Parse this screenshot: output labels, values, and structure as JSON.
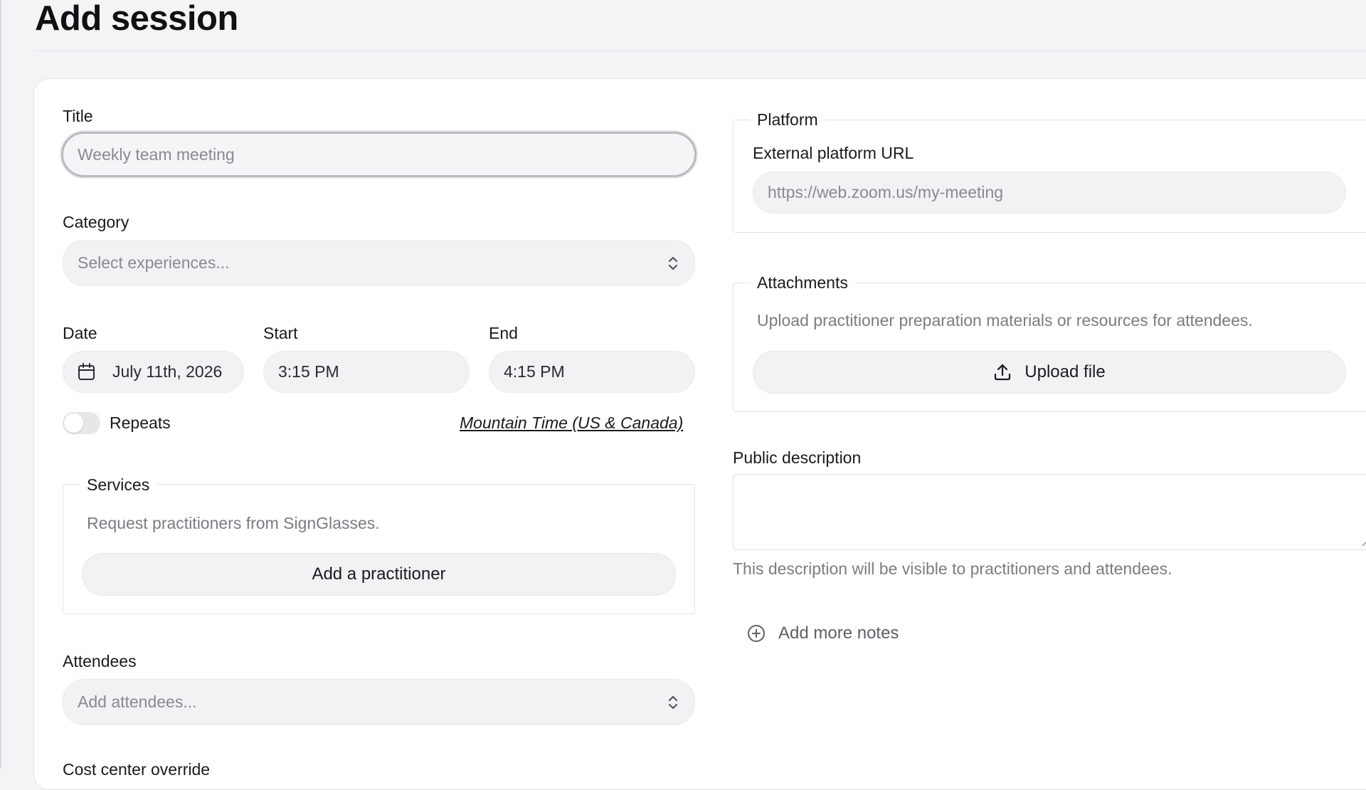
{
  "page": {
    "title": "Add session"
  },
  "form": {
    "title": {
      "label": "Title",
      "placeholder": "Weekly team meeting"
    },
    "category": {
      "label": "Category",
      "placeholder": "Select experiences..."
    },
    "date": {
      "label": "Date",
      "value": "July 11th, 2026"
    },
    "start": {
      "label": "Start",
      "value": "3:15 PM"
    },
    "end": {
      "label": "End",
      "value": "4:15 PM"
    },
    "repeats": {
      "label": "Repeats",
      "on": false
    },
    "timezone": "Mountain Time (US & Canada)",
    "services": {
      "legend": "Services",
      "help": "Request practitioners from SignGlasses.",
      "button_label": "Add a practitioner"
    },
    "attendees": {
      "label": "Attendees",
      "placeholder": "Add attendees..."
    },
    "cost_center_label": "Cost center override"
  },
  "side": {
    "platform": {
      "legend": "Platform",
      "url_label": "External platform URL",
      "url_placeholder": "https://web.zoom.us/my-meeting"
    },
    "attachments": {
      "legend": "Attachments",
      "help": "Upload practitioner preparation materials or resources for attendees.",
      "button_label": "Upload file"
    },
    "public_description": {
      "label": "Public description",
      "help": "This description will be visible to practitioners and attendees."
    },
    "add_notes_label": "Add more notes"
  },
  "icons": {
    "calendar": "calendar-icon",
    "chevron": "chevron-up-down-icon",
    "upload": "upload-icon",
    "add": "plus-circle-icon"
  },
  "colors": {
    "background": "#f4f3f6",
    "card": "#ffffff",
    "field": "#f2f2f4",
    "text": "#1a1a1f",
    "muted": "#7c7b82"
  }
}
